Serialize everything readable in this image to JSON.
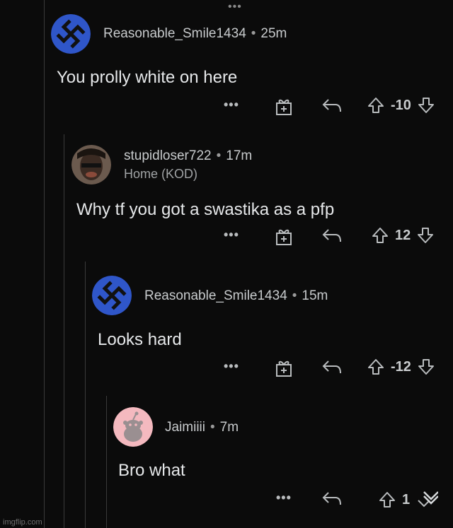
{
  "top_dots": "•••",
  "comments": [
    {
      "username": "Reasonable_Smile1434",
      "time": "25m",
      "text": "You prolly white on here",
      "votes": "-10",
      "more": "•••"
    },
    {
      "username": "stupidloser722",
      "time": "17m",
      "flair": "Home (KOD)",
      "text": "Why tf you got a swastika as a pfp",
      "votes": "12",
      "more": "•••"
    },
    {
      "username": "Reasonable_Smile1434",
      "time": "15m",
      "text": "Looks hard",
      "votes": "-12",
      "more": "•••"
    },
    {
      "username": "Jaimiiii",
      "time": "7m",
      "text": "Bro what",
      "votes": "1",
      "more": "•••"
    }
  ],
  "separator": "•",
  "watermark": "imgflip.com",
  "colors": {
    "background": "#0b0b0b",
    "avatar_blue": "#2f56c9",
    "avatar_pink": "#f4b9bf"
  }
}
